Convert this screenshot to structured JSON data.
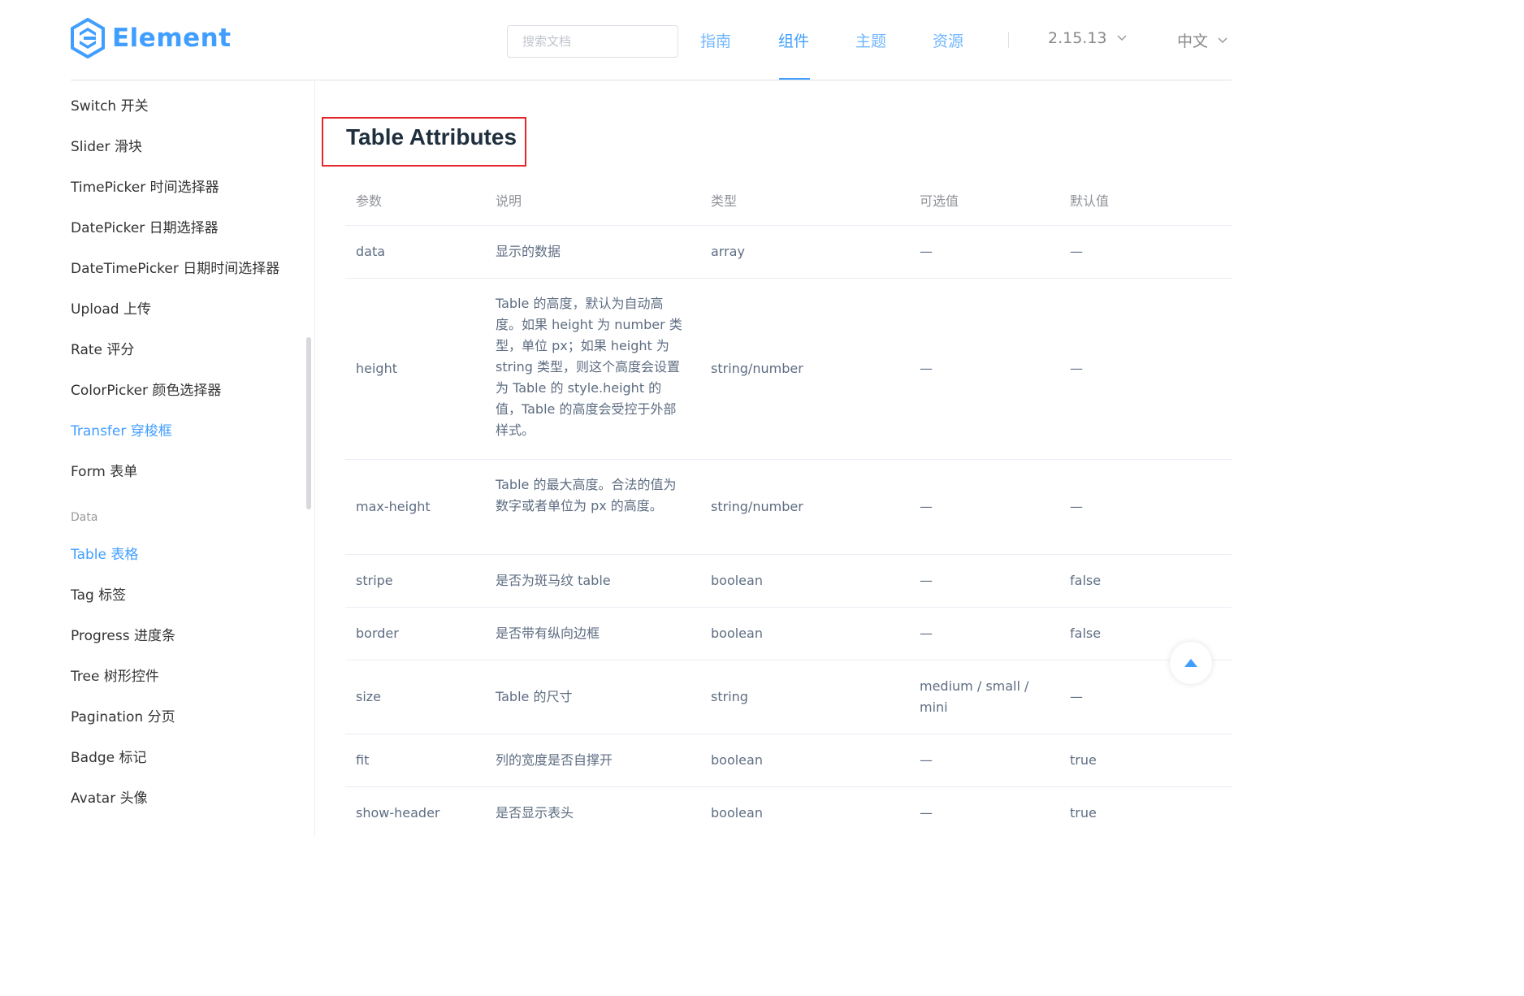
{
  "brand": {
    "name": "Element",
    "color": "#409eff"
  },
  "search": {
    "placeholder": "搜索文档",
    "value": ""
  },
  "nav": {
    "items": [
      {
        "label": "指南",
        "active": false
      },
      {
        "label": "组件",
        "active": true
      },
      {
        "label": "主题",
        "active": false
      },
      {
        "label": "资源",
        "active": false
      }
    ],
    "version": "2.15.13",
    "language": "中文"
  },
  "sidebar": {
    "items": [
      {
        "label": "Switch 开关",
        "active": false
      },
      {
        "label": "Slider 滑块",
        "active": false
      },
      {
        "label": "TimePicker 时间选择器",
        "active": false
      },
      {
        "label": "DatePicker 日期选择器",
        "active": false
      },
      {
        "label": "DateTimePicker 日期时间选择器",
        "active": false
      },
      {
        "label": "Upload 上传",
        "active": false
      },
      {
        "label": "Rate 评分",
        "active": false
      },
      {
        "label": "ColorPicker 颜色选择器",
        "active": false
      },
      {
        "label": "Transfer 穿梭框",
        "active": true
      },
      {
        "label": "Form 表单",
        "active": false
      }
    ],
    "group_label": "Data",
    "group_items": [
      {
        "label": "Table 表格",
        "active": true
      },
      {
        "label": "Tag 标签",
        "active": false
      },
      {
        "label": "Progress 进度条",
        "active": false
      },
      {
        "label": "Tree 树形控件",
        "active": false
      },
      {
        "label": "Pagination 分页",
        "active": false
      },
      {
        "label": "Badge 标记",
        "active": false
      },
      {
        "label": "Avatar 头像",
        "active": false
      }
    ]
  },
  "main": {
    "section_title": "Table Attributes",
    "columns": [
      "参数",
      "说明",
      "类型",
      "可选值",
      "默认值"
    ],
    "rows": [
      {
        "param": "data",
        "desc": "显示的数据",
        "type": "array",
        "options": "—",
        "default": "—"
      },
      {
        "param": "height",
        "desc": "Table 的高度，默认为自动高度。如果 height 为 number 类型，单位 px；如果 height 为 string 类型，则这个高度会设置为 Table 的 style.height 的值，Table 的高度会受控于外部样式。",
        "type": "string/number",
        "options": "—",
        "default": "—"
      },
      {
        "param": "max-height",
        "desc": "Table 的最大高度。合法的值为数字或者单位为 px 的高度。",
        "type": "string/number",
        "options": "—",
        "default": "—"
      },
      {
        "param": "stripe",
        "desc": "是否为斑马纹 table",
        "type": "boolean",
        "options": "—",
        "default": "false"
      },
      {
        "param": "border",
        "desc": "是否带有纵向边框",
        "type": "boolean",
        "options": "—",
        "default": "false"
      },
      {
        "param": "size",
        "desc": "Table 的尺寸",
        "type": "string",
        "options": "medium / small / mini",
        "default": "—"
      },
      {
        "param": "fit",
        "desc": "列的宽度是否自撑开",
        "type": "boolean",
        "options": "—",
        "default": "true"
      },
      {
        "param": "show-header",
        "desc": "是否显示表头",
        "type": "boolean",
        "options": "—",
        "default": "true"
      }
    ]
  }
}
